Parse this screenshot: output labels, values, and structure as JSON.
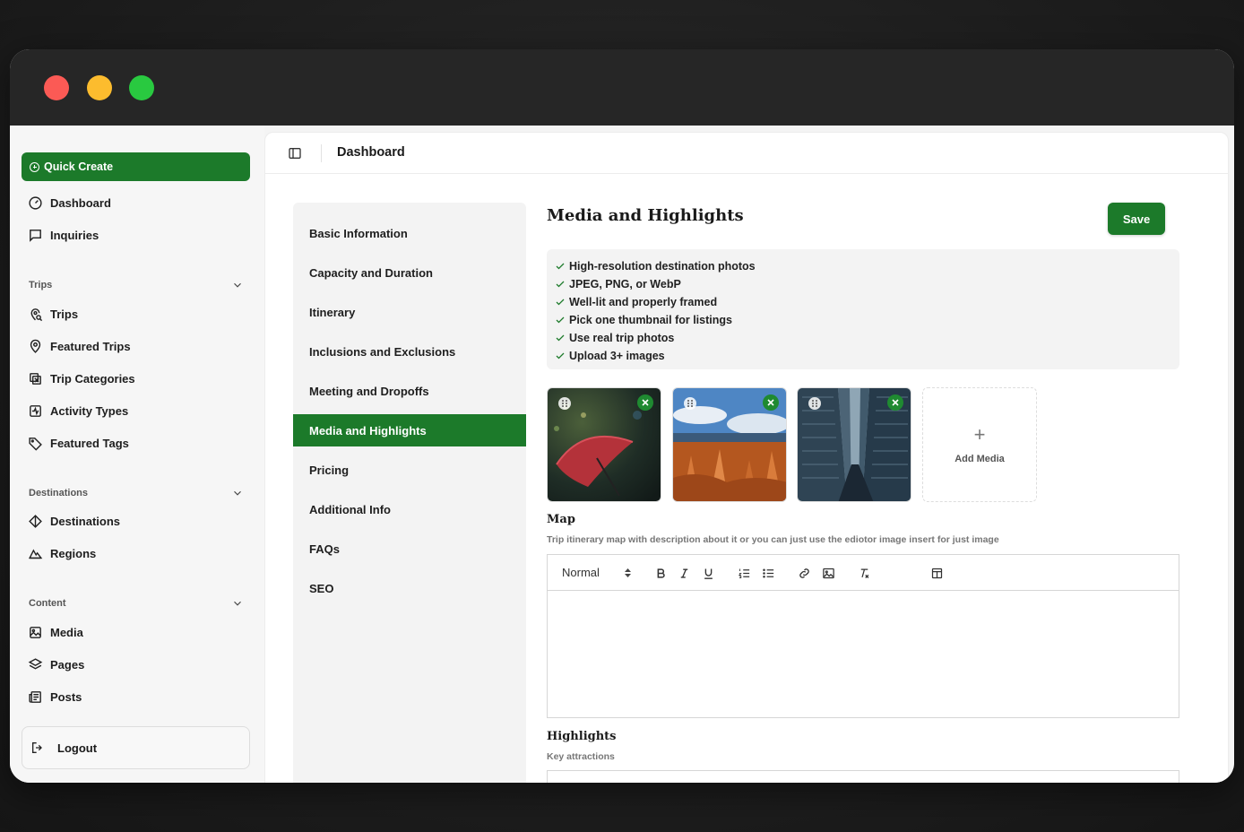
{
  "sidebar": {
    "quick_create": "Quick Create",
    "top_items": [
      {
        "label": "Dashboard",
        "icon": "gauge-icon"
      },
      {
        "label": "Inquiries",
        "icon": "message-square-icon"
      }
    ],
    "groups": [
      {
        "title": "Trips",
        "items": [
          {
            "label": "Trips",
            "icon": "map-pin-search-icon"
          },
          {
            "label": "Featured Trips",
            "icon": "map-pin-icon"
          },
          {
            "label": "Trip Categories",
            "icon": "category-icon"
          },
          {
            "label": "Activity Types",
            "icon": "activity-icon"
          },
          {
            "label": "Featured Tags",
            "icon": "tag-icon"
          }
        ]
      },
      {
        "title": "Destinations",
        "items": [
          {
            "label": "Destinations",
            "icon": "compass-icon"
          },
          {
            "label": "Regions",
            "icon": "mountain-icon"
          }
        ]
      },
      {
        "title": "Content",
        "items": [
          {
            "label": "Media",
            "icon": "image-icon"
          },
          {
            "label": "Pages",
            "icon": "layers-icon"
          },
          {
            "label": "Posts",
            "icon": "newspaper-icon"
          }
        ]
      }
    ],
    "logout": "Logout"
  },
  "header": {
    "title": "Dashboard"
  },
  "steps": [
    "Basic Information",
    "Capacity and Duration",
    "Itinerary",
    "Inclusions and Exclusions",
    "Meeting and Dropoffs",
    "Media and Highlights",
    "Pricing",
    "Additional Info",
    "FAQs",
    "SEO"
  ],
  "active_step": "Media and Highlights",
  "content": {
    "title": "Media and Highlights",
    "save_label": "Save",
    "guidelines": [
      "High-resolution destination photos",
      "JPEG, PNG, or WebP",
      "Well-lit and properly framed",
      "Pick one thumbnail for listings",
      "Use real trip photos",
      "Upload 3+ images"
    ],
    "add_media_label": "Add Media",
    "map": {
      "title": "Map",
      "description": "Trip itinerary map with description about it or you can just use the ediotor image insert for just image",
      "format_value": "Normal"
    },
    "highlights": {
      "title": "Highlights",
      "description": "Key attractions"
    }
  },
  "colors": {
    "brand_green": "#1c7a2a",
    "remove_green": "#1f8a31"
  }
}
